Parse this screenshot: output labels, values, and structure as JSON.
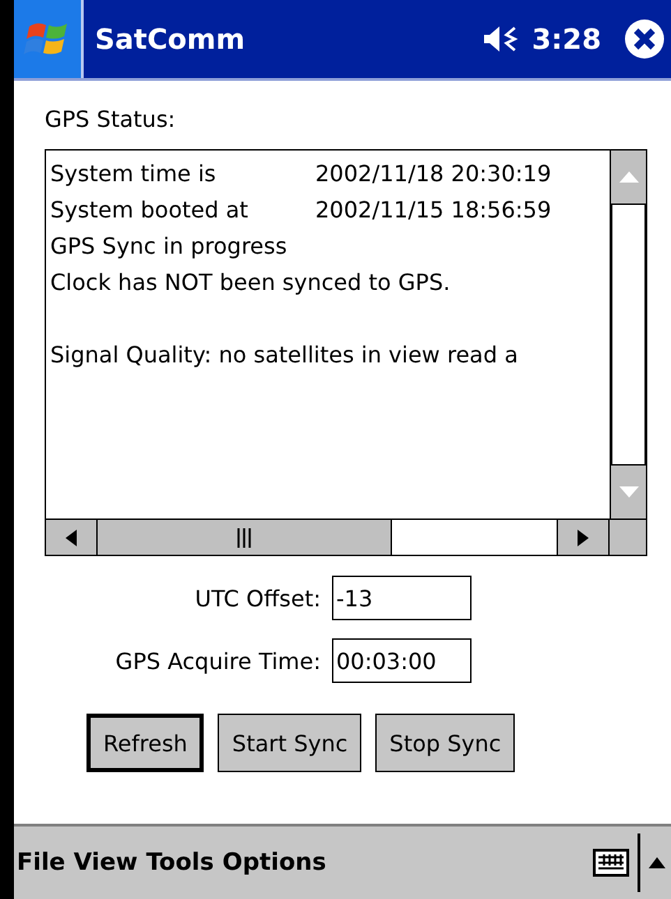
{
  "title_bar": {
    "title": "SatComm",
    "time": "3:28"
  },
  "status_label": "GPS Status:",
  "status_lines": [
    {
      "kind": "pair",
      "label": "System time is",
      "value": "2002/11/18 20:30:19"
    },
    {
      "kind": "pair",
      "label": "System booted at",
      "value": "2002/11/15 18:56:59"
    },
    {
      "kind": "text",
      "text": "GPS Sync in progress"
    },
    {
      "kind": "text",
      "text": "Clock has NOT been synced to GPS."
    },
    {
      "kind": "blank"
    },
    {
      "kind": "text",
      "text": "Signal Quality: no satellites in view read a"
    }
  ],
  "fields": [
    {
      "label": "UTC Offset:",
      "value": "-13"
    },
    {
      "label": "GPS Acquire Time:",
      "value": "00:03:00"
    }
  ],
  "buttons": [
    {
      "label": "Refresh",
      "default": true
    },
    {
      "label": "Start Sync",
      "default": false
    },
    {
      "label": "Stop Sync",
      "default": false
    }
  ],
  "menu_bar": [
    "File",
    "View",
    "Tools",
    "Options"
  ]
}
